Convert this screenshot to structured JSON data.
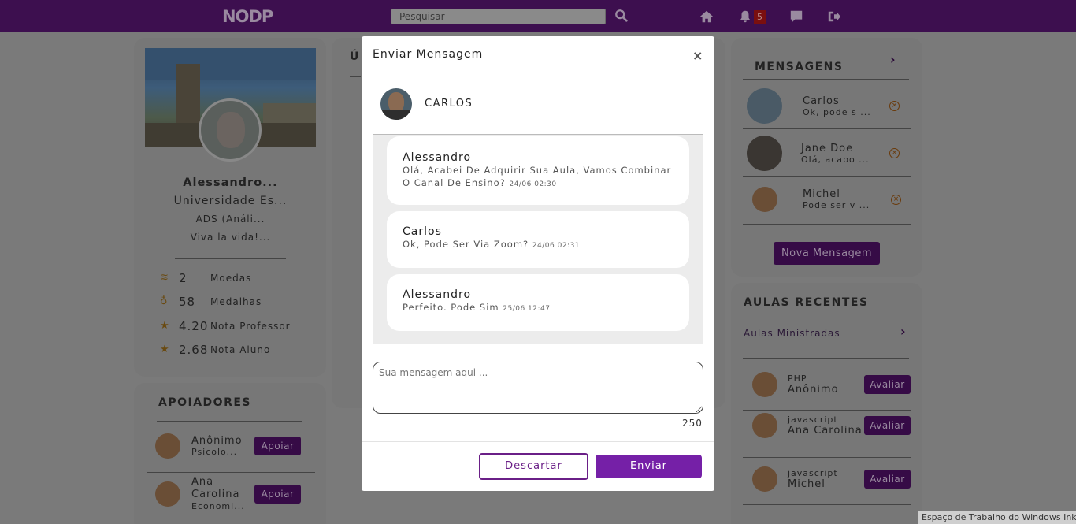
{
  "topbar": {
    "logo": "NODP",
    "search_placeholder": "Pesquisar",
    "notification_count": "5"
  },
  "profile": {
    "name": "Alessandro...",
    "university": "Universidade Es...",
    "course": "ADS (Análi...",
    "motto": "Viva la vida!...",
    "stats": [
      {
        "icon": "coins-icon",
        "value": "2",
        "label": "Moedas"
      },
      {
        "icon": "medal-icon",
        "value": "58",
        "label": "Medalhas"
      },
      {
        "icon": "star-icon",
        "value": "4.20",
        "label": "Nota Professor"
      },
      {
        "icon": "star-icon",
        "value": "2.68",
        "label": "Nota Aluno"
      }
    ]
  },
  "supporters": {
    "title": "APOIADORES",
    "items": [
      {
        "name": "Anônimo",
        "sub": "Psicolo...",
        "button": "Apoiar"
      },
      {
        "name": "Ana Carolina",
        "sub": "Economi...",
        "button": "Apoiar"
      }
    ]
  },
  "middle": {
    "title_partial": "Ú"
  },
  "messages": {
    "title": "MENSAGENS",
    "items": [
      {
        "name": "Carlos",
        "preview": "Ok, pode s ..."
      },
      {
        "name": "Jane Doe",
        "preview": "Olá, acabo ..."
      },
      {
        "name": "Michel",
        "preview": "Pode ser v ..."
      }
    ],
    "new_button": "Nova Mensagem"
  },
  "recent_classes": {
    "title": "AULAS RECENTES",
    "subtitle": "Aulas Ministradas",
    "items": [
      {
        "subject": "PHP",
        "teacher": "Anônimo",
        "button": "Avaliar"
      },
      {
        "subject": "javascript",
        "teacher": "Ana Carolina",
        "button": "Avaliar"
      },
      {
        "subject": "javascript",
        "teacher": "Michel",
        "button": "Avaliar"
      }
    ]
  },
  "modal": {
    "title": "Enviar Mensagem",
    "close": "×",
    "recipient": "CARLOS",
    "messages": [
      {
        "author": "Alessandro",
        "text": "Olá, Acabei De Adquirir Sua Aula, Vamos Combinar O Canal De Ensino?",
        "time": "24/06 02:30"
      },
      {
        "author": "Carlos",
        "text": "Ok, Pode Ser Via Zoom?",
        "time": "24/06 02:31"
      },
      {
        "author": "Alessandro",
        "text": "Perfeito. Pode Sim",
        "time": "25/06 12:47"
      }
    ],
    "input_placeholder": "Sua mensagem aqui ...",
    "char_count": "250",
    "discard_label": "Descartar",
    "send_label": "Enviar"
  },
  "taskbar": {
    "ink_workspace": "Espaço de Trabalho do Windows Ink"
  },
  "colors": {
    "brand": "#7520a7",
    "topbar": "#3d0f4f"
  }
}
